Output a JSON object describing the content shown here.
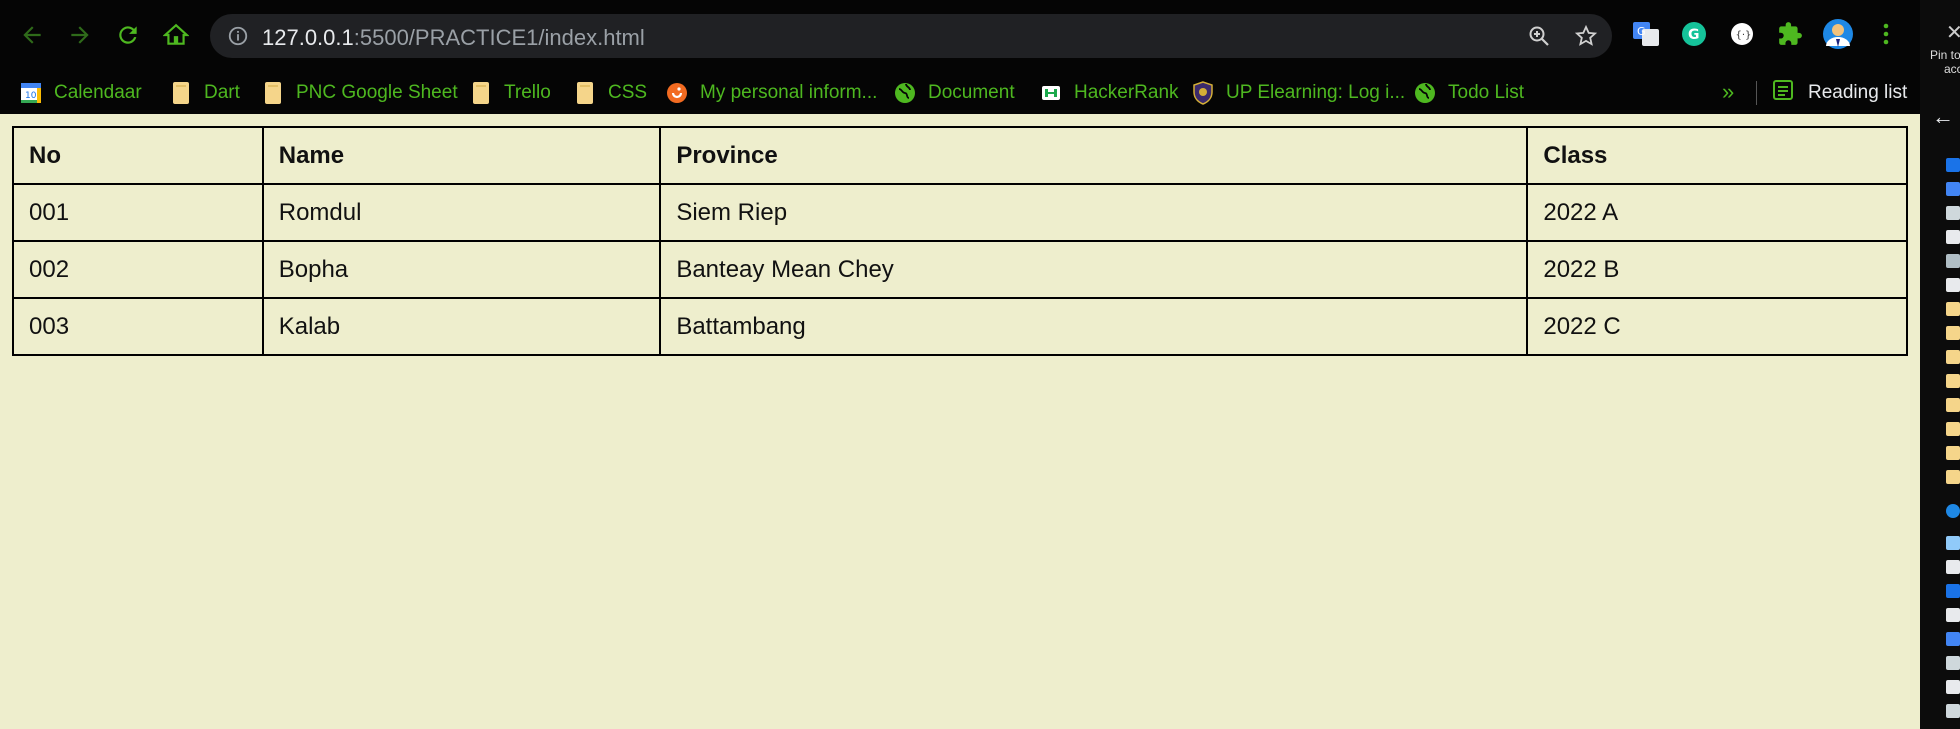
{
  "browser": {
    "url_host": "127.0.0.1",
    "url_rest": ":5500/PRACTICE1/index.html"
  },
  "bookmarks": [
    {
      "label": "Calendaar",
      "icon": "calendar-icon"
    },
    {
      "label": "Dart",
      "icon": "folder-icon"
    },
    {
      "label": "PNC Google Sheet",
      "icon": "folder-icon"
    },
    {
      "label": "Trello",
      "icon": "folder-icon"
    },
    {
      "label": "CSS",
      "icon": "folder-icon"
    },
    {
      "label": "My personal inform...",
      "icon": "site-icon"
    },
    {
      "label": "Document",
      "icon": "globe-icon"
    },
    {
      "label": "HackerRank",
      "icon": "hackerrank-icon"
    },
    {
      "label": "UP Elearning: Log i...",
      "icon": "shield-icon"
    },
    {
      "label": "Todo List",
      "icon": "globe-icon"
    }
  ],
  "overflow_label": "»",
  "reading_list_label": "Reading list",
  "side_panel": {
    "pin_text": "Pin to",
    "pin_text_2": "acc"
  },
  "table": {
    "headers": [
      "No",
      "Name",
      "Province",
      "Class"
    ],
    "rows": [
      [
        "001",
        "Romdul",
        "Siem Riep",
        "2022 A"
      ],
      [
        "002",
        "Bopha",
        "Banteay Mean Chey",
        "2022 B"
      ],
      [
        "003",
        "Kalab",
        "Battambang",
        "2022 C"
      ]
    ]
  },
  "colors": {
    "page_background": "#eeeecd",
    "bookmark_text": "#4eb820",
    "chrome_background": "#050505"
  }
}
